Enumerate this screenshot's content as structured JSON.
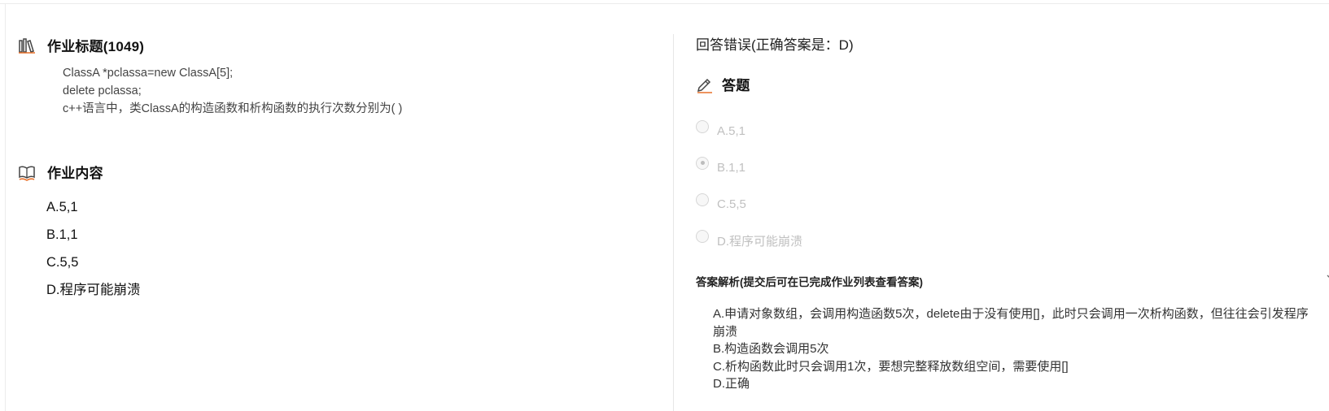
{
  "left": {
    "title_section": {
      "icon": "books-icon",
      "heading": "作业标题(1049)",
      "question_lines": [
        "ClassA *pclassa=new ClassA[5];",
        "delete pclassa;",
        "c++语言中，类ClassA的构造函数和析构函数的执行次数分别为( )"
      ]
    },
    "content_section": {
      "icon": "open-book-icon",
      "heading": "作业内容",
      "options": [
        "A.5,1",
        "B.1,1",
        "C.5,5",
        "D.程序可能崩溃"
      ]
    }
  },
  "right": {
    "result_text": "回答错误(正确答案是：D)",
    "answer_section": {
      "icon": "pen-icon",
      "heading": "答题",
      "options": [
        {
          "label": "A.5,1",
          "checked": false
        },
        {
          "label": "B.1,1",
          "checked": true
        },
        {
          "label": "C.5,5",
          "checked": false
        },
        {
          "label": "D.程序可能崩溃",
          "checked": false
        }
      ]
    },
    "analysis": {
      "title": "答案解析(提交后可在已完成作业列表查看答案)",
      "lines": [
        "A.申请对象数组，会调用构造函数5次，delete由于没有使用[]，此时只会调用一次析构函数，但往往会引发程序崩溃",
        "B.构造函数会调用5次",
        "C.析构函数此时只会调用1次，要想完整释放数组空间，需要使用[]",
        "D.正确"
      ]
    }
  },
  "colors": {
    "accent_orange": "#e8702a",
    "disabled_text": "#c0c0c0"
  }
}
